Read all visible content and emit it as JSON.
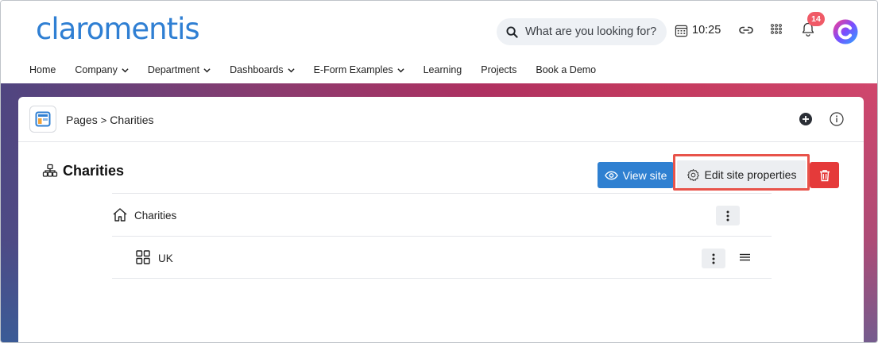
{
  "header": {
    "logo": "claromentis",
    "search_placeholder": "What are you looking for?",
    "time": "10:25",
    "notification_count": "14"
  },
  "nav": {
    "items": [
      {
        "label": "Home",
        "dropdown": false
      },
      {
        "label": "Company",
        "dropdown": true
      },
      {
        "label": "Department",
        "dropdown": true
      },
      {
        "label": "Dashboards",
        "dropdown": true
      },
      {
        "label": "E-Form Examples",
        "dropdown": true
      },
      {
        "label": "Learning",
        "dropdown": false
      },
      {
        "label": "Projects",
        "dropdown": false
      },
      {
        "label": "Book a Demo",
        "dropdown": false
      }
    ]
  },
  "breadcrumb": {
    "root": "Pages",
    "separator": ">",
    "current": "Charities"
  },
  "site": {
    "title": "Charities",
    "view_label": "View site",
    "edit_label": "Edit site properties"
  },
  "tree": {
    "rows": [
      {
        "label": "Charities",
        "icon": "home-icon"
      },
      {
        "label": "UK",
        "icon": "grid-icon"
      }
    ]
  },
  "colors": {
    "brand": "#2f7fd3",
    "primary_button": "#2f80d1",
    "danger_button": "#e53a3a",
    "highlight": "#e8534a",
    "badge": "#f05a67"
  }
}
